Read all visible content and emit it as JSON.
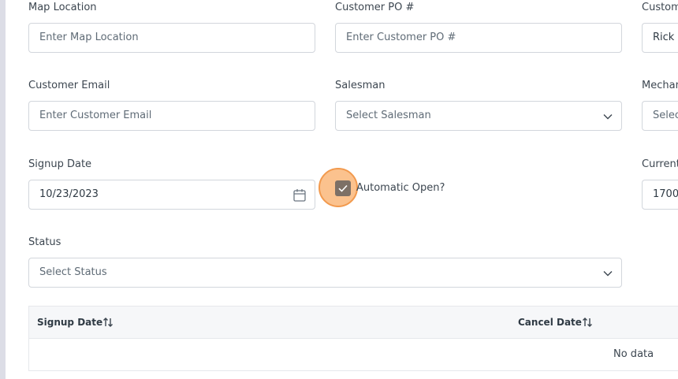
{
  "form": {
    "map_location": {
      "label": "Map Location",
      "placeholder": "Enter Map Location"
    },
    "customer_po": {
      "label": "Customer PO #",
      "placeholder": "Enter Customer PO #"
    },
    "customer_name": {
      "label": "Custome",
      "value": "Rick L"
    },
    "customer_email": {
      "label": "Customer Email",
      "placeholder": "Enter Customer Email"
    },
    "salesman": {
      "label": "Salesman",
      "placeholder": "Select Salesman"
    },
    "mechanic": {
      "label": "Mechan",
      "placeholder": "Selec"
    },
    "signup_date": {
      "label": "Signup Date",
      "value": "10/23/2023"
    },
    "automatic_open": {
      "label": "Automatic Open?",
      "checked": true
    },
    "current": {
      "label": "Current",
      "value": "1700("
    },
    "status": {
      "label": "Status",
      "placeholder": "Select Status"
    }
  },
  "table": {
    "columns": [
      "Signup Date",
      "Cancel Date"
    ],
    "empty_text": "No data"
  },
  "icons": {
    "dropdown": "chevron-down-icon",
    "calendar": "calendar-icon",
    "sort": "sort-icon",
    "check": "check-icon"
  },
  "colors": {
    "checkbox_fill": "#7d7066",
    "focus_ring": "#f29a4e",
    "border": "#d2d6dc"
  }
}
